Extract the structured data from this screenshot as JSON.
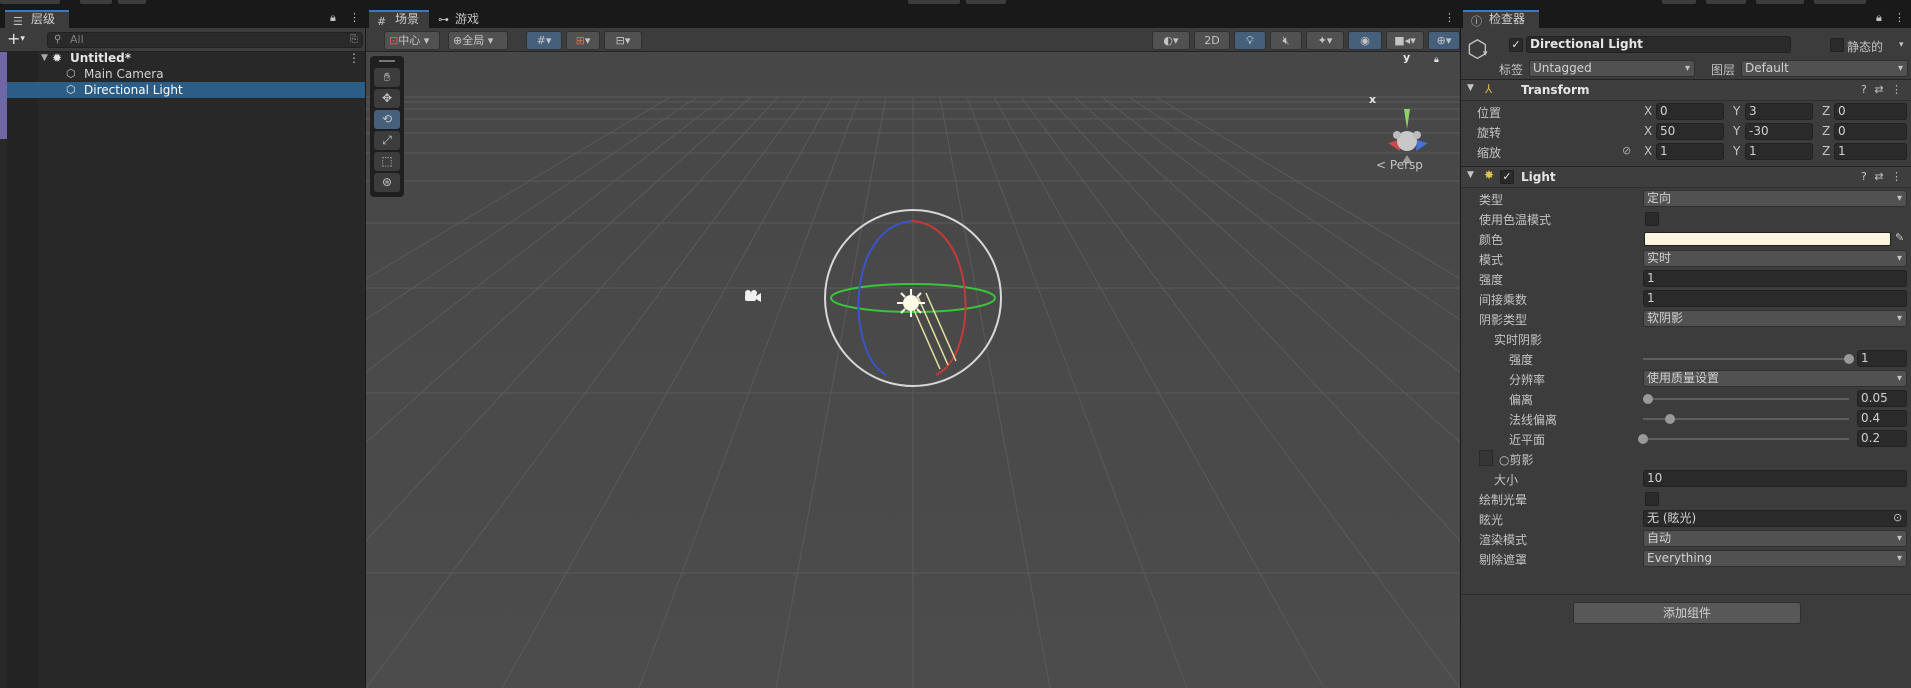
{
  "hierarchy": {
    "tab_label": "层级",
    "search_placeholder": "All",
    "scene_name": "Untitled*",
    "items": [
      {
        "label": "Main Camera"
      },
      {
        "label": "Directional Light"
      }
    ]
  },
  "scene": {
    "tabs": [
      {
        "label": "场景"
      },
      {
        "label": "游戏"
      }
    ],
    "toolbar": {
      "pivot_label": "中心",
      "space_label": "全局",
      "mode_2d_label": "2D"
    },
    "gizmo": {
      "axis_x": "x",
      "axis_y": "y",
      "persp_label": "Persp"
    }
  },
  "inspector": {
    "tab_label": "检查器",
    "object_name": "Directional Light",
    "static_label": "静态的",
    "tag_label": "标签",
    "tag_value": "Untagged",
    "layer_label": "图层",
    "layer_value": "Default",
    "transform": {
      "title": "Transform",
      "position_label": "位置",
      "rotation_label": "旋转",
      "scale_label": "缩放",
      "axis_x": "X",
      "axis_y": "Y",
      "axis_z": "Z",
      "position": {
        "x": "0",
        "y": "3",
        "z": "0"
      },
      "rotation": {
        "x": "50",
        "y": "-30",
        "z": "0"
      },
      "scale": {
        "x": "1",
        "y": "1",
        "z": "1"
      }
    },
    "light": {
      "title": "Light",
      "type_label": "类型",
      "type_value": "定向",
      "use_color_temp_label": "使用色温模式",
      "color_label": "颜色",
      "color_value": "#fff4e0",
      "mode_label": "模式",
      "mode_value": "实时",
      "intensity_label": "强度",
      "intensity_value": "1",
      "indirect_label": "间接乘数",
      "indirect_value": "1",
      "shadow_type_label": "阴影类型",
      "shadow_type_value": "软阴影",
      "realtime_shadows_label": "实时阴影",
      "strength_label": "强度",
      "strength_value": "1",
      "strength_fraction": 1.0,
      "resolution_label": "分辨率",
      "resolution_value": "使用质量设置",
      "bias_label": "偏离",
      "bias_value": "0.05",
      "bias_fraction": 0.025,
      "normal_bias_label": "法线偏离",
      "normal_bias_value": "0.4",
      "normal_bias_fraction": 0.133,
      "near_plane_label": "近平面",
      "near_plane_value": "0.2",
      "near_plane_fraction": 0.0,
      "cookie_label": "○剪影",
      "size_label": "大小",
      "size_value": "10",
      "draw_halo_label": "绘制光晕",
      "flare_label": "眩光",
      "flare_value": "无 (眩光)",
      "render_mode_label": "渲染模式",
      "render_mode_value": "自动",
      "culling_mask_label": "剔除遮罩",
      "culling_mask_value": "Everything"
    },
    "add_component_label": "添加组件"
  }
}
